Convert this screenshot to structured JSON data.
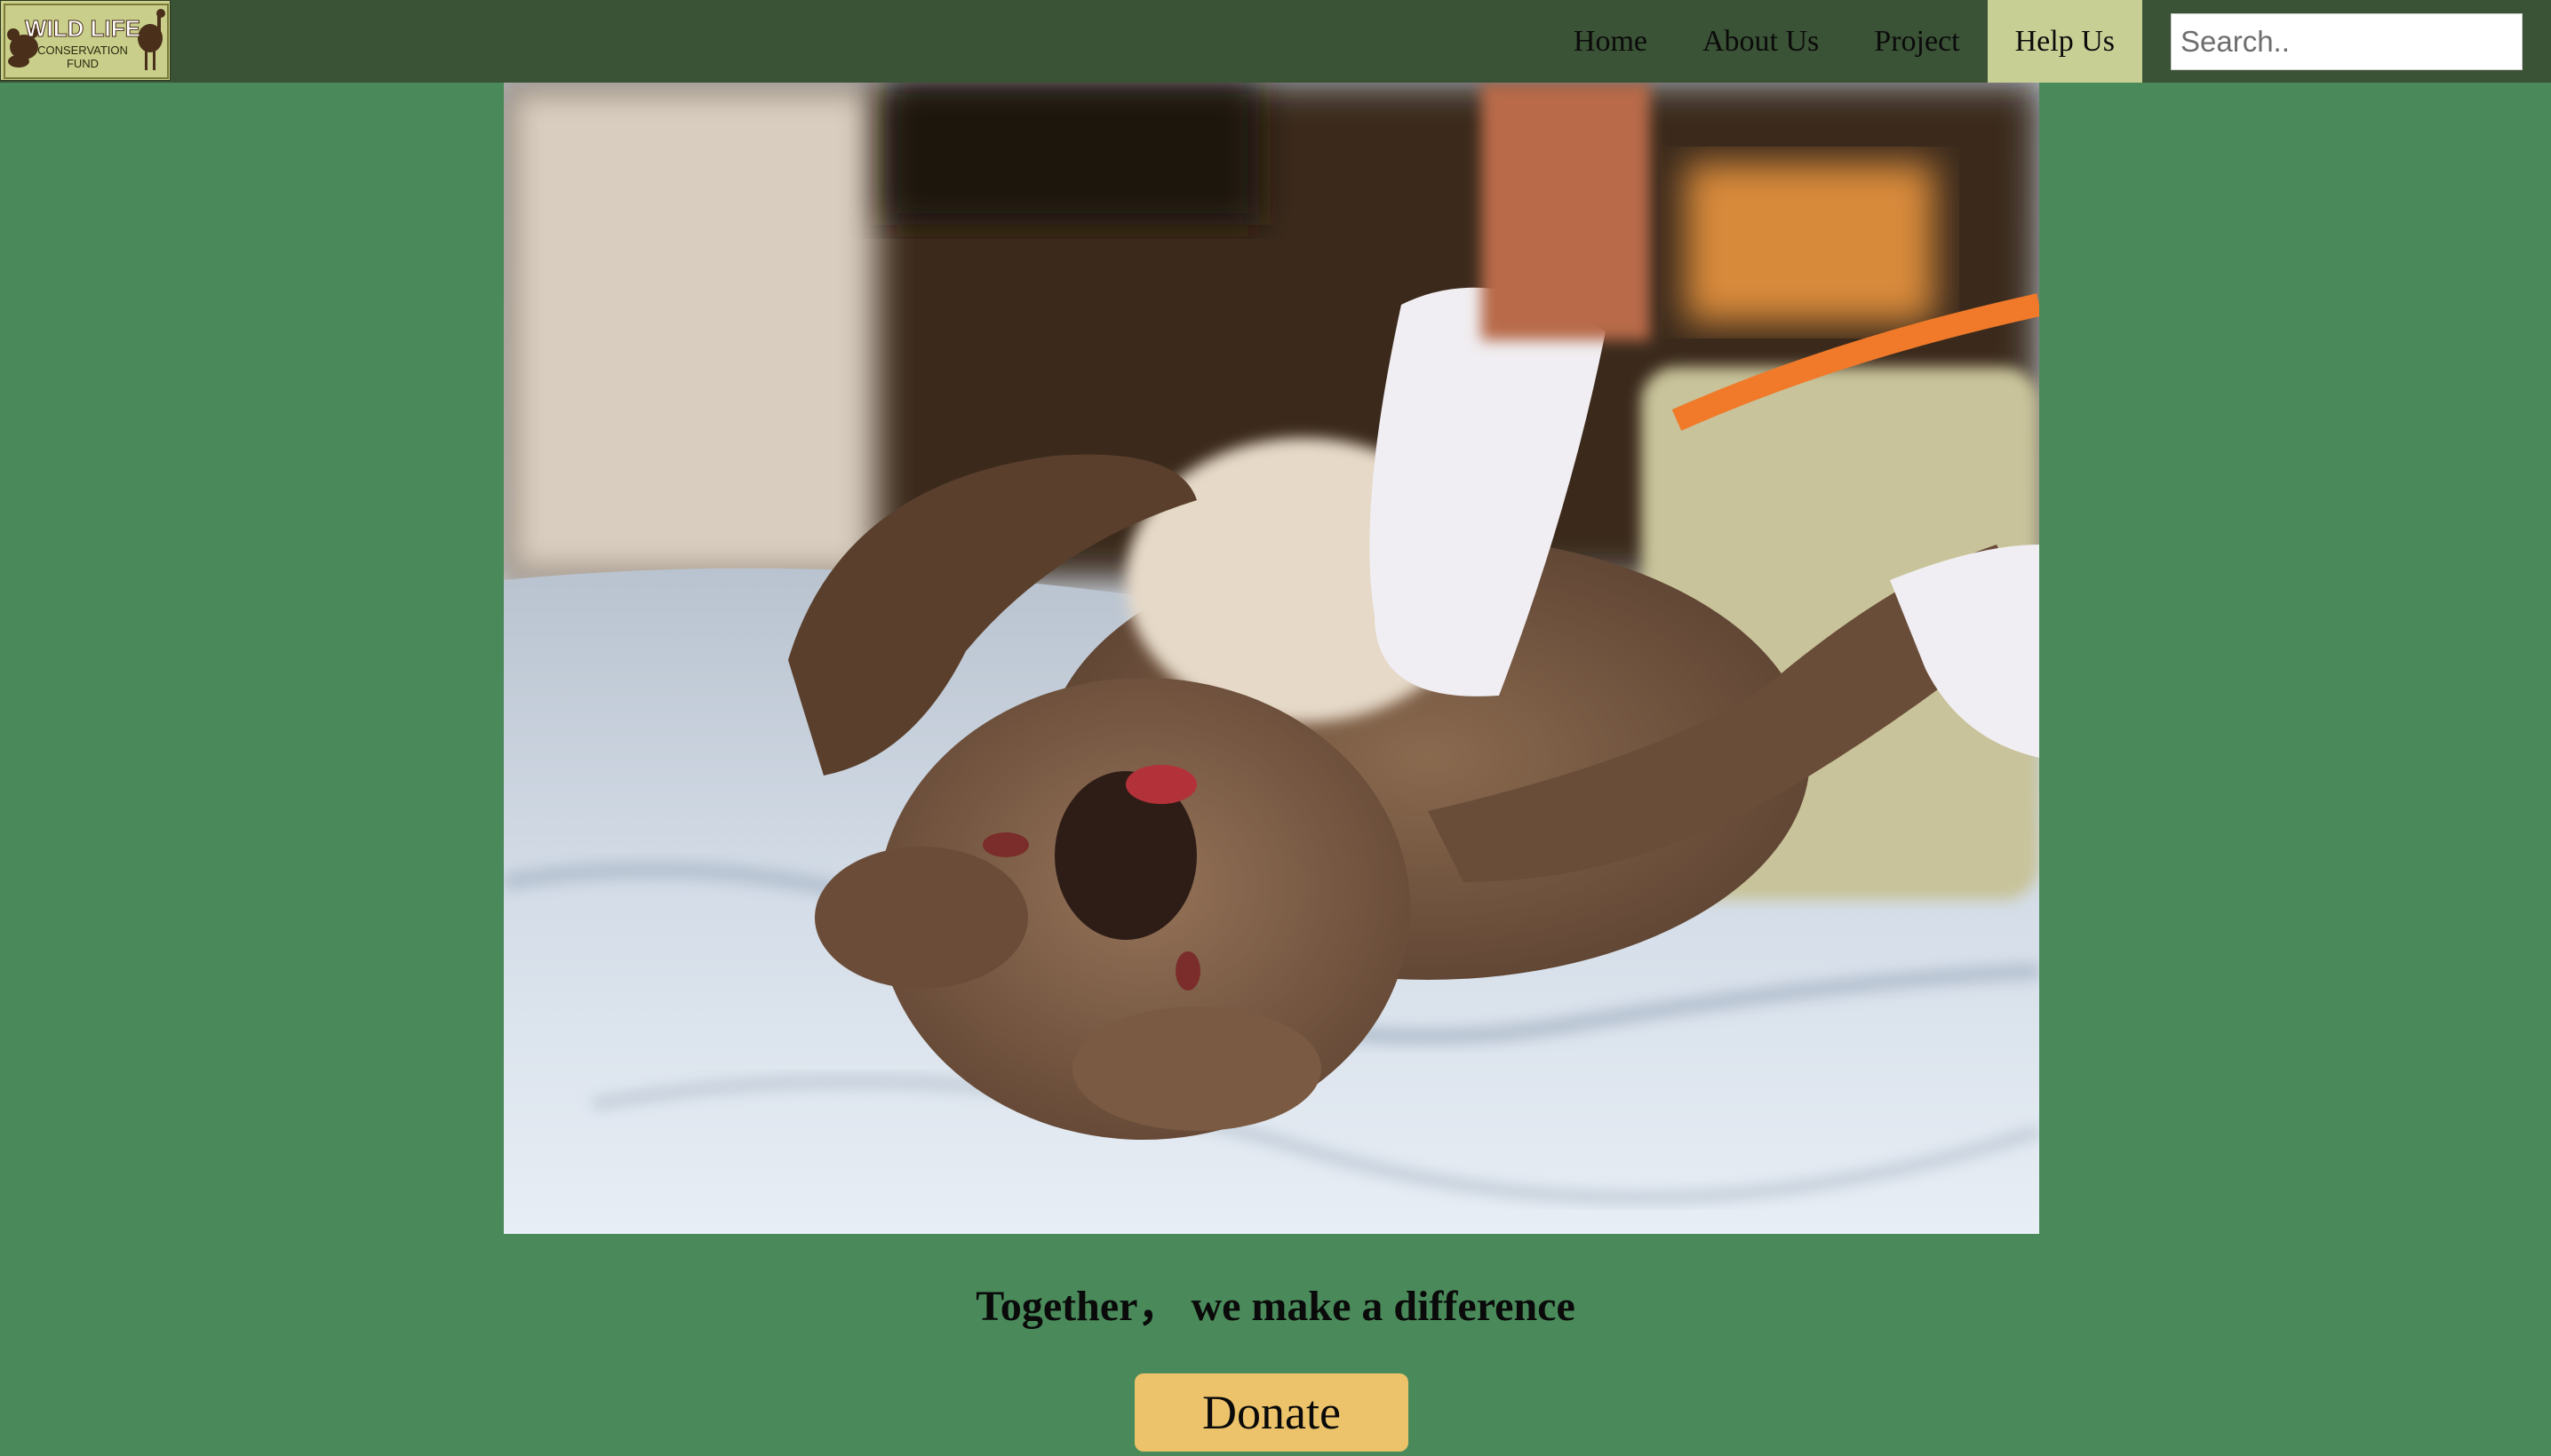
{
  "brand": {
    "logo_line1": "WILD LIFE",
    "logo_line2": "CONSERVATION",
    "logo_line3": "FUND"
  },
  "nav": {
    "items": [
      {
        "label": "Home",
        "active": false
      },
      {
        "label": "About Us",
        "active": false
      },
      {
        "label": "Project",
        "active": false
      },
      {
        "label": "Help Us",
        "active": true
      }
    ]
  },
  "search": {
    "placeholder": "Search..",
    "value": ""
  },
  "hero": {
    "image_alt": "Injured koala receiving veterinary care"
  },
  "main": {
    "tagline": "Together， we make a difference",
    "donate_label": "Donate"
  },
  "colors": {
    "page_bg": "#4a8a5a",
    "topbar_bg": "#3a5235",
    "active_nav_bg": "#c8cf95",
    "donate_bg": "#ecc36a"
  }
}
